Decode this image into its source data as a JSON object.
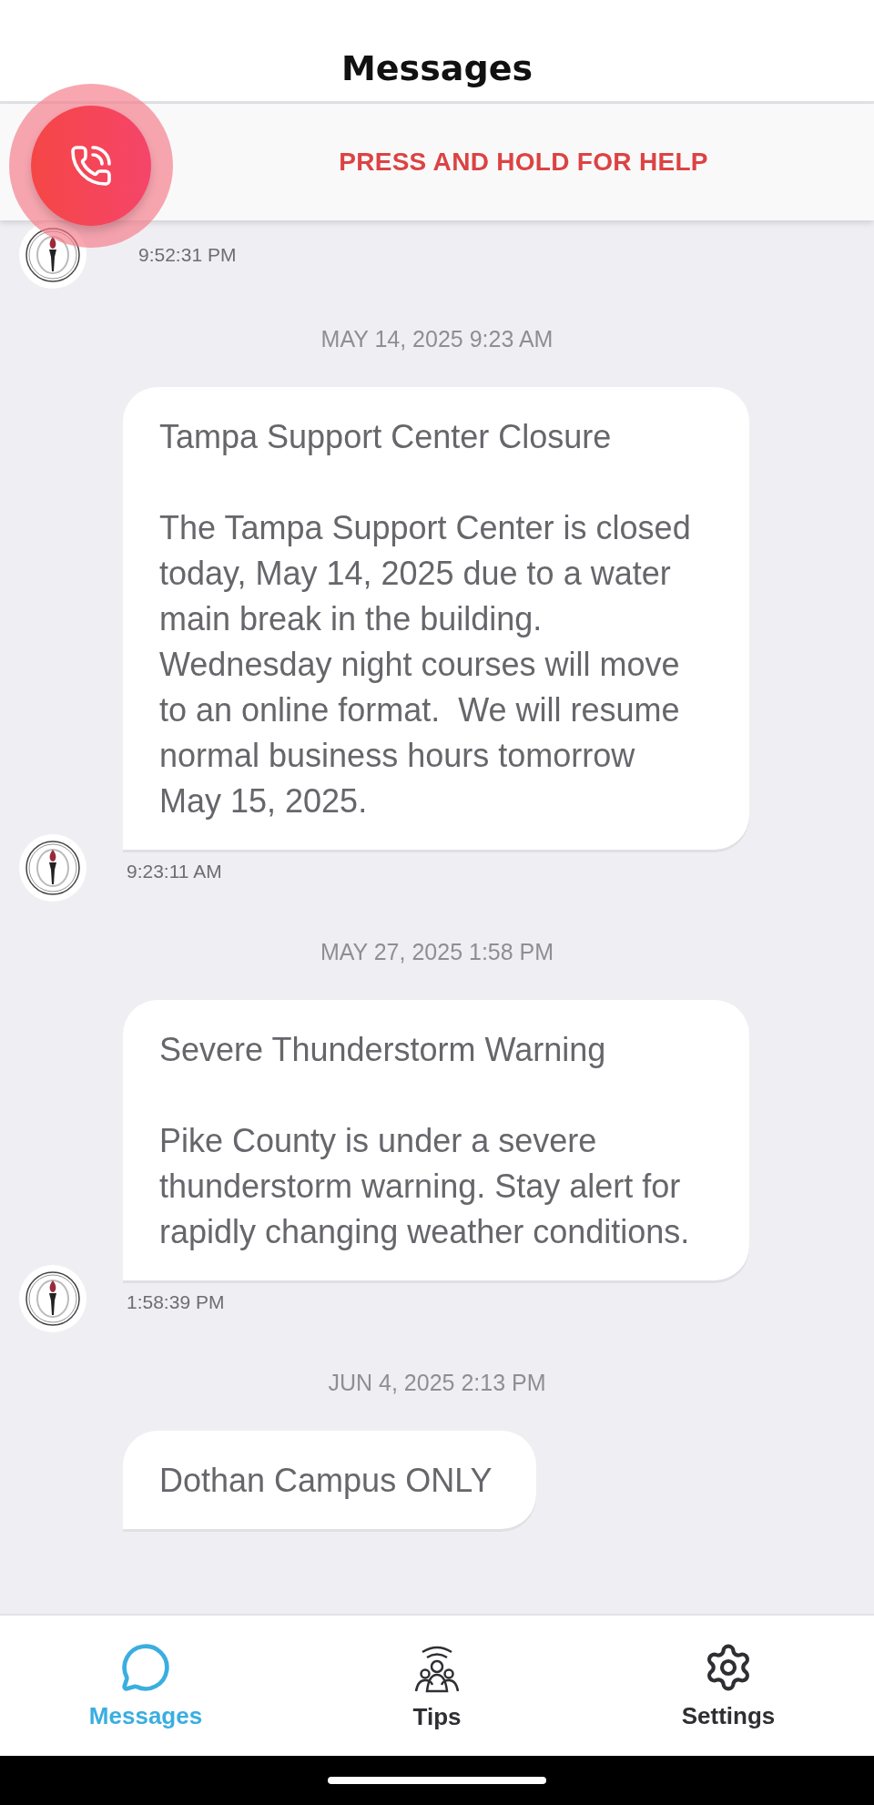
{
  "header": {
    "title": "Messages"
  },
  "help_banner": {
    "label": "PRESS AND HOLD FOR HELP"
  },
  "previous_message": {
    "time": "9:52:31 PM"
  },
  "messages": [
    {
      "date": "MAY 14, 2025 9:23 AM",
      "title": "Tampa Support Center Closure",
      "body": "The Tampa Support Center is closed today, May 14, 2025 due to a water main break in the building.  Wednesday night courses will move to an online format.  We will resume normal business hours tomorrow May 15, 2025.",
      "time": "9:23:11 AM"
    },
    {
      "date": "MAY 27, 2025 1:58 PM",
      "title": "Severe Thunderstorm Warning",
      "body": "Pike County is under a severe thunderstorm warning. Stay alert for rapidly changing weather conditions.",
      "time": "1:58:39 PM"
    },
    {
      "date": "JUN 4, 2025 2:13 PM",
      "title": "Dothan Campus ONLY"
    }
  ],
  "tabs": [
    {
      "kind": "messages",
      "label": "Messages",
      "selected": true
    },
    {
      "kind": "tips",
      "label": "Tips",
      "selected": false
    },
    {
      "kind": "settings",
      "label": "Settings",
      "selected": false
    }
  ]
}
